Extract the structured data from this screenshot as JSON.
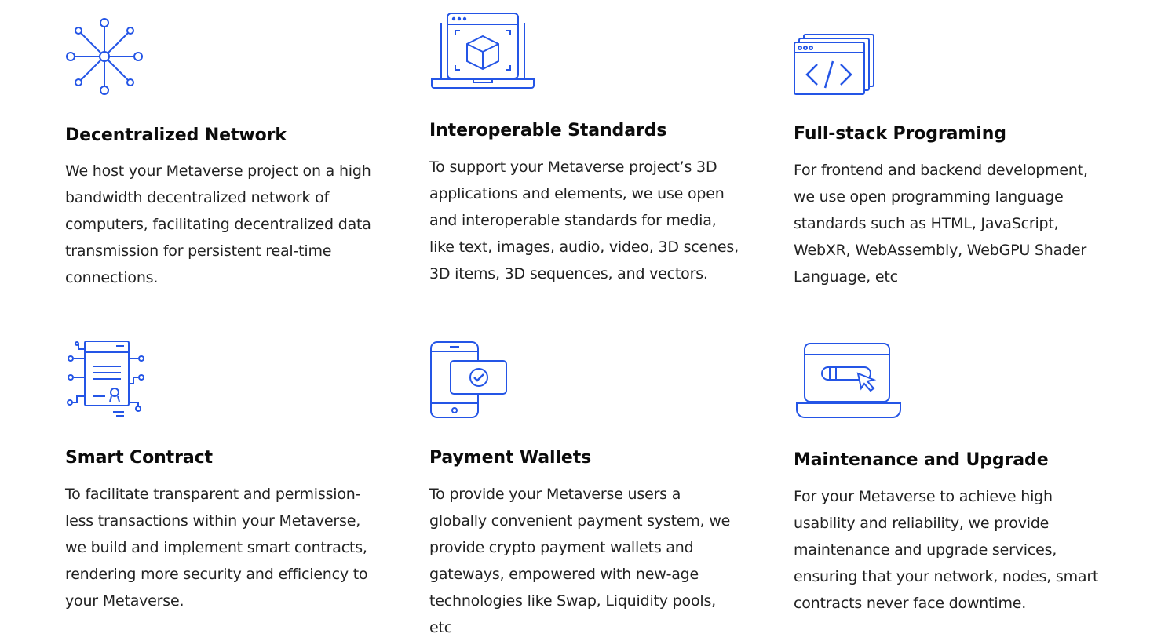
{
  "colors": {
    "icon": "#2455e6",
    "title": "#0b0b0b",
    "text": "#222222"
  },
  "features": [
    {
      "icon": "network-nodes-icon",
      "title": "Decentralized Network",
      "description": "We host your Metaverse project on a high bandwidth decentralized network of computers, facilitating decentralized data transmission for persistent real-time connections."
    },
    {
      "icon": "laptop-3d-cube-icon",
      "title": "Interoperable Standards",
      "description": "To support your Metaverse project’s 3D applications and elements, we use open and interoperable standards for media, like text, images, audio, video, 3D scenes, 3D items, 3D sequences, and vectors."
    },
    {
      "icon": "browser-code-icon",
      "title": "Full-stack Programing",
      "description": "For frontend and backend development, we use open programming language standards such as HTML, JavaScript, WebXR, WebAssembly, WebGPU Shader Language, etc"
    },
    {
      "icon": "smart-contract-document-icon",
      "title": "Smart Contract",
      "description": "To facilitate transparent and permission-less transactions within your Metaverse, we build and implement smart contracts, rendering more security and efficiency to your Metaverse."
    },
    {
      "icon": "mobile-wallet-check-icon",
      "title": "Payment Wallets",
      "description": "To provide your Metaverse users a globally convenient payment system, we provide crypto payment wallets and gateways, empowered with new-age technologies like Swap, Liquidity pools, etc"
    },
    {
      "icon": "laptop-upgrade-cursor-icon",
      "title": "Maintenance and Upgrade",
      "description": "For your Metaverse to achieve high usability and reliability, we provide maintenance and upgrade services, ensuring that your network, nodes, smart contracts never face downtime."
    }
  ]
}
